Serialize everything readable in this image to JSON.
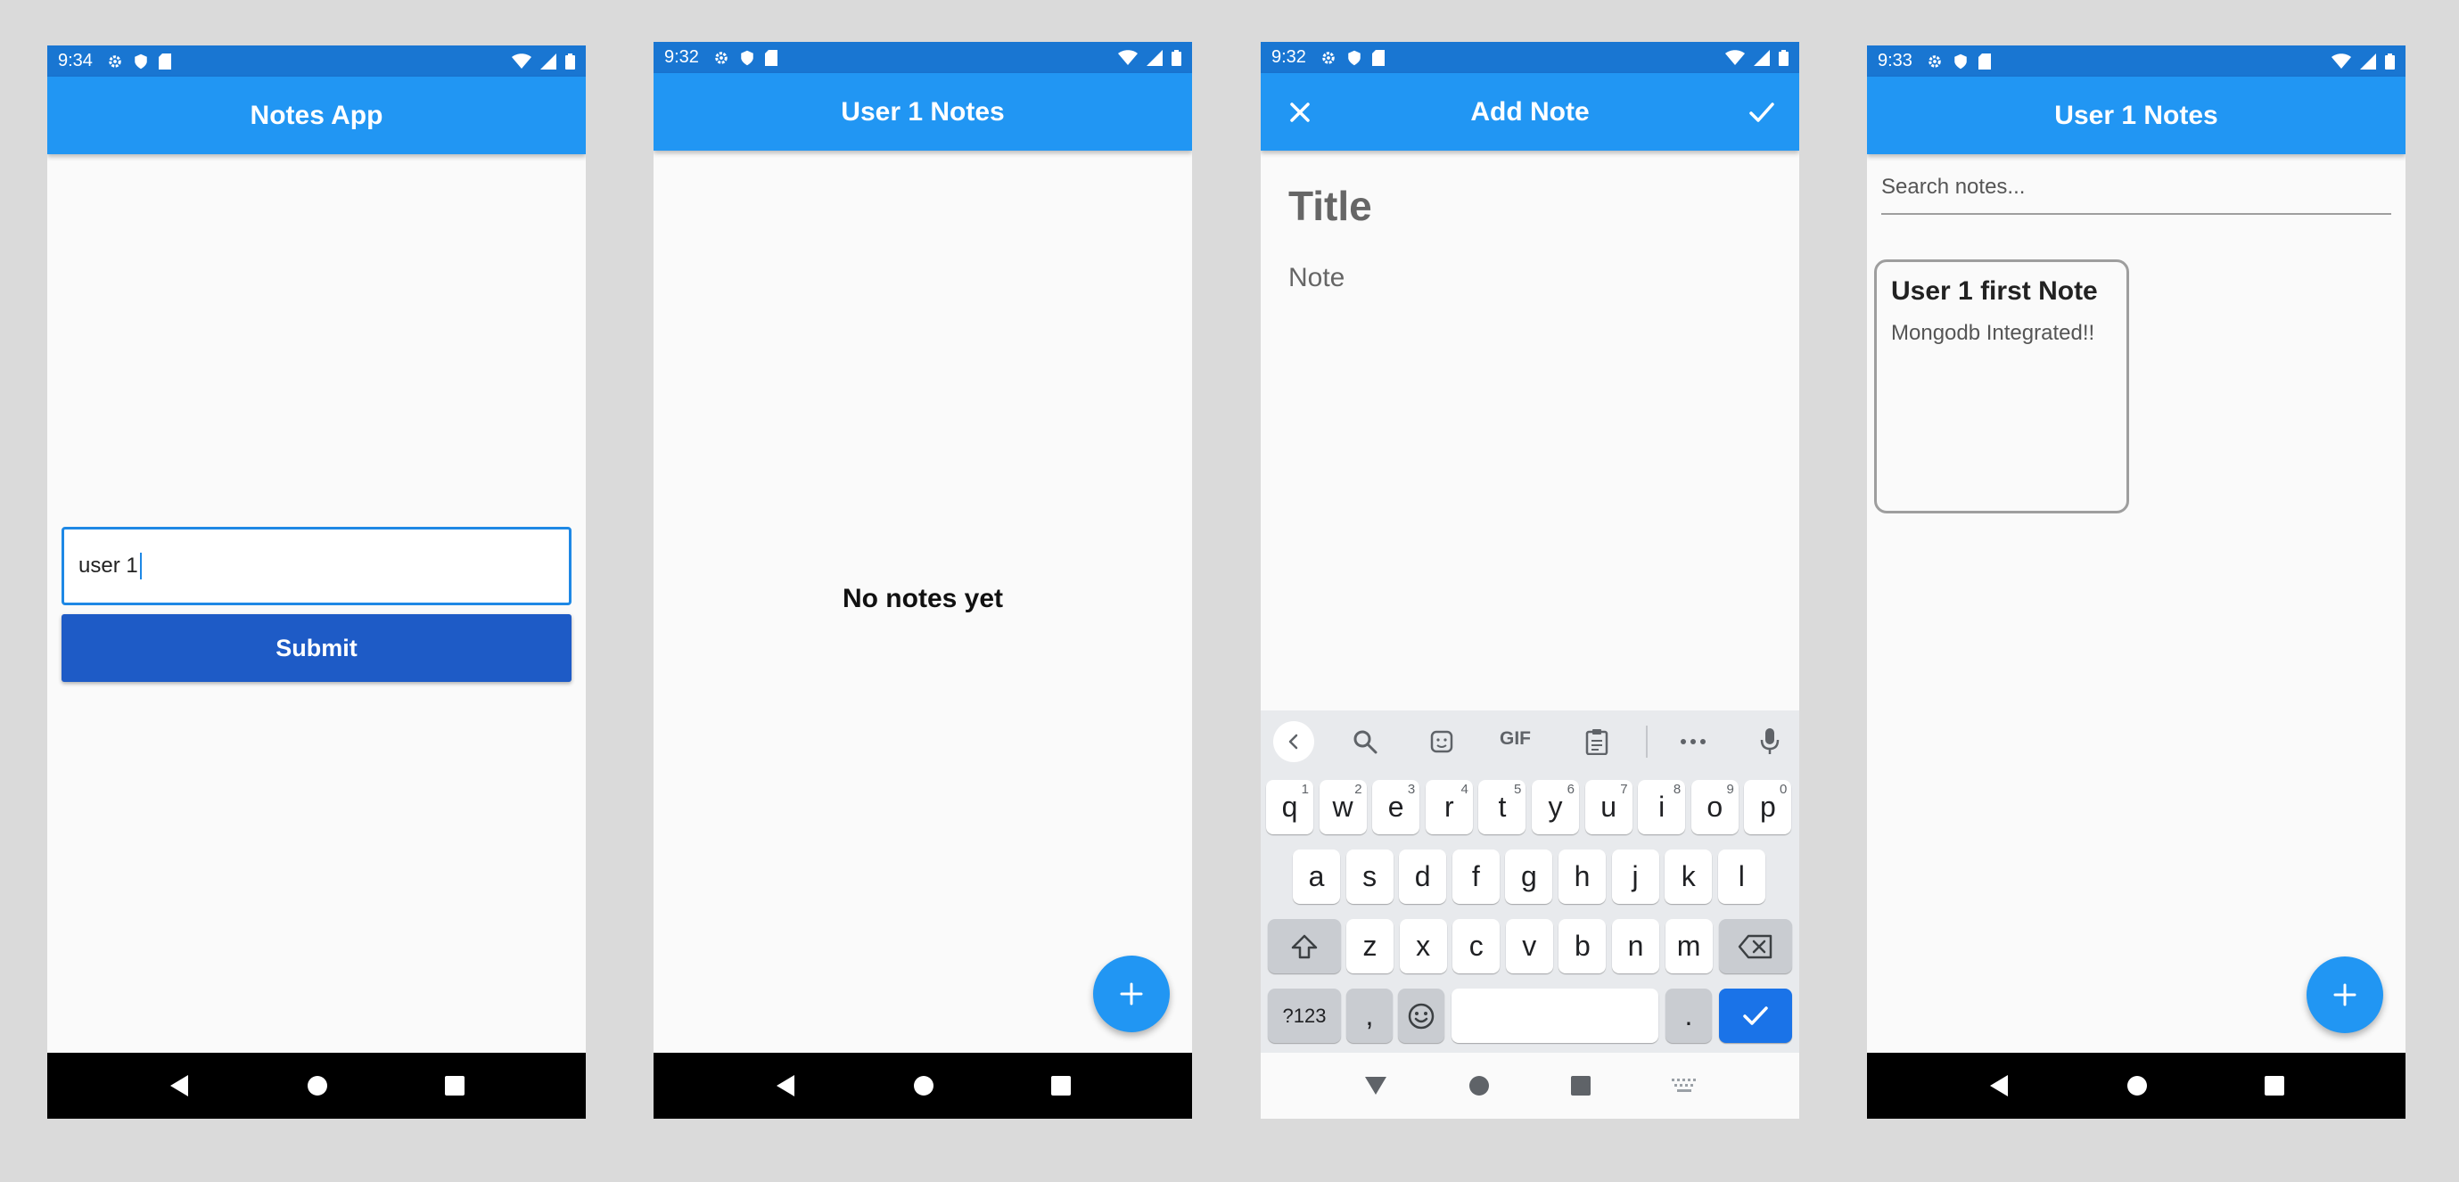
{
  "screens": [
    {
      "status_time": "9:34",
      "appbar_title": "Notes App",
      "username_input_value": "user 1",
      "submit_label": "Submit"
    },
    {
      "status_time": "9:32",
      "appbar_title": "User 1 Notes",
      "empty_message": "No notes yet",
      "fab_icon": "plus-icon"
    },
    {
      "status_time": "9:32",
      "appbar_title": "Add Note",
      "title_placeholder": "Title",
      "note_placeholder": "Note",
      "keyboard": {
        "gif_label": "GIF",
        "row1": [
          {
            "k": "q",
            "h": "1"
          },
          {
            "k": "w",
            "h": "2"
          },
          {
            "k": "e",
            "h": "3"
          },
          {
            "k": "r",
            "h": "4"
          },
          {
            "k": "t",
            "h": "5"
          },
          {
            "k": "y",
            "h": "6"
          },
          {
            "k": "u",
            "h": "7"
          },
          {
            "k": "i",
            "h": "8"
          },
          {
            "k": "o",
            "h": "9"
          },
          {
            "k": "p",
            "h": "0"
          }
        ],
        "row2": [
          "a",
          "s",
          "d",
          "f",
          "g",
          "h",
          "j",
          "k",
          "l"
        ],
        "row3": [
          "z",
          "x",
          "c",
          "v",
          "b",
          "n",
          "m"
        ],
        "symbols_label": "?123",
        "comma_label": ",",
        "period_label": "."
      }
    },
    {
      "status_time": "9:33",
      "appbar_title": "User 1 Notes",
      "search_placeholder": "Search notes...",
      "notes": [
        {
          "title": "User 1 first Note",
          "body": "Mongodb Integrated!!"
        }
      ]
    }
  ],
  "colors": {
    "status_bar": "#1976d2",
    "app_bar": "#2196f3",
    "submit": "#1e5bc6",
    "keyboard_action": "#1a73e8"
  }
}
